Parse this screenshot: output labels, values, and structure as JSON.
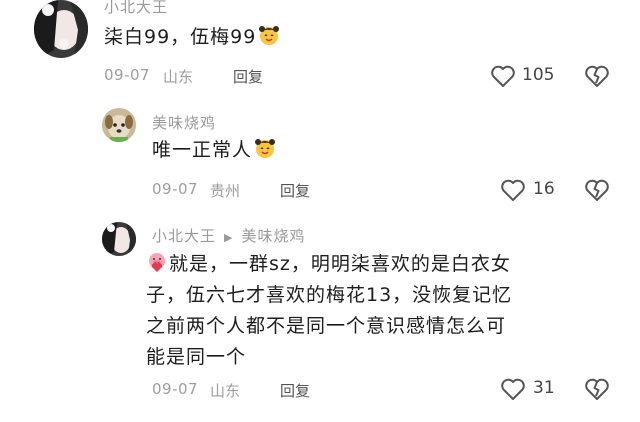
{
  "comments": [
    {
      "username": "小北大王",
      "text": "柒白99，伍梅99",
      "date": "09-07",
      "location": "山东",
      "reply_label": "回复",
      "likes": "105"
    },
    {
      "username": "美味烧鸡",
      "text": "唯一正常人",
      "date": "09-07",
      "location": "贵州",
      "reply_label": "回复",
      "likes": "16"
    },
    {
      "username": "小北大王",
      "reply_to": "美味烧鸡",
      "text_lines": [
        "就是，一群sz，明明柒喜欢的是白衣女",
        "子，伍六七才喜欢的梅花13，没恢复记忆",
        "之前两个人都不是同一个意识感情怎么可",
        "能是同一个"
      ],
      "date": "09-07",
      "location": "山东",
      "reply_label": "回复",
      "likes": "31"
    }
  ],
  "icons": {
    "like": "heart-outline-icon",
    "dislike": "broken-heart-icon",
    "emoji_face": "smiling-face-emoji",
    "emoji_pig": "pig-heart-emoji",
    "reply_arrow": "play-arrow-icon"
  },
  "colors": {
    "text_primary": "#1d1d1d",
    "text_meta": "#9d9d9d",
    "username": "#9a9a9a"
  }
}
